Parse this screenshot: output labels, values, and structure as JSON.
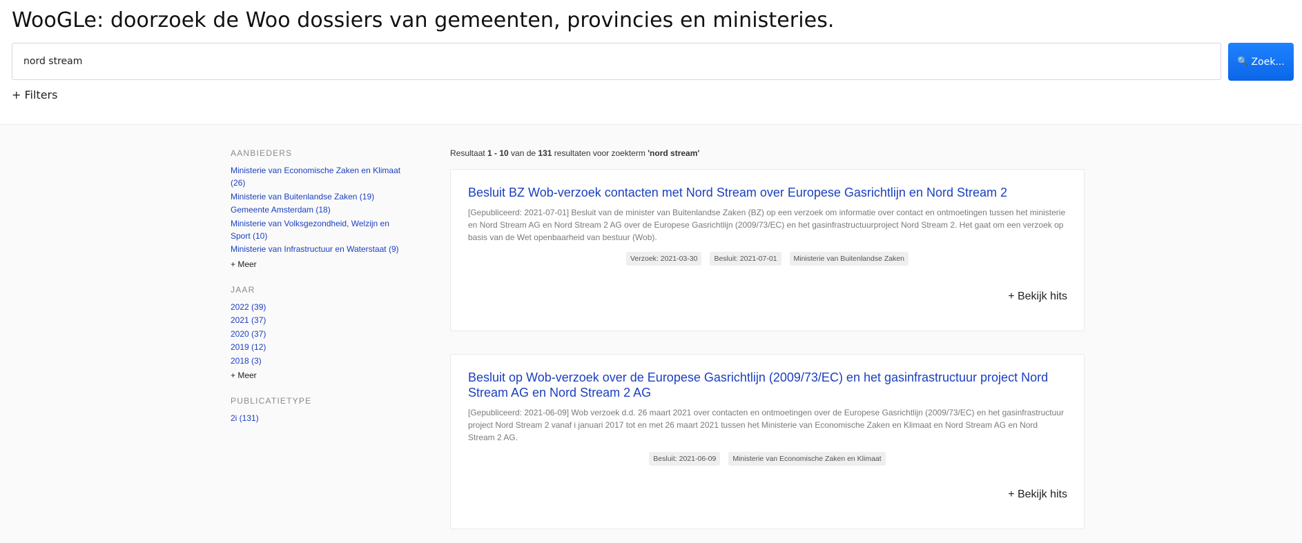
{
  "header": {
    "title": "WooGLe: doorzoek de Woo dossiers van gemeenten, provincies en ministeries.",
    "search_value": "nord stream",
    "search_button_label": "Zoek...",
    "search_icon": "magnifier-icon",
    "filters_label": "+ Filters"
  },
  "sidebar": {
    "groups": [
      {
        "heading": "AANBIEDERS",
        "items": [
          "Ministerie van Economische Zaken en Klimaat (26)",
          "Ministerie van Buitenlandse Zaken (19)",
          "Gemeente Amsterdam (18)",
          "Ministerie van Volksgezondheid, Welzijn en Sport (10)",
          "Ministerie van Infrastructuur en Waterstaat (9)"
        ],
        "more_label": "+ Meer"
      },
      {
        "heading": "JAAR",
        "items": [
          "2022 (39)",
          "2021 (37)",
          "2020 (37)",
          "2019 (12)",
          "2018 (3)"
        ],
        "more_label": "+ Meer"
      },
      {
        "heading": "PUBLICATIETYPE",
        "items": [
          "2i (131)"
        ]
      }
    ]
  },
  "results": {
    "summary": {
      "prefix": "Resultaat ",
      "range": "1 - 10",
      "mid": " van de ",
      "total": "131",
      "suffix": " resultaten voor zoekterm ",
      "query": "'nord stream'"
    },
    "items": [
      {
        "title": "Besluit BZ Wob-verzoek contacten met Nord Stream over Europese Gasrichtlijn en Nord Stream 2",
        "snippet": "[Gepubliceerd: 2021-07-01] Besluit van de minister van Buitenlandse Zaken (BZ) op een verzoek om informatie over contact en ontmoetingen tussen het ministerie en Nord Stream AG en Nord Stream 2 AG over de Europese Gasrichtlijn (2009/73/EC) en het gasinfrastructuurproject Nord Stream 2. Het gaat om een verzoek op basis van de Wet openbaarheid van bestuur (Wob).",
        "tags": [
          "Verzoek: 2021-03-30",
          "Besluit: 2021-07-01",
          "Ministerie van Buitenlandse Zaken"
        ],
        "hits_label": "+ Bekijk hits"
      },
      {
        "title": "Besluit op Wob-verzoek over de Europese Gasrichtlijn (2009/73/EC) en het gasinfrastructuur project Nord Stream AG en Nord Stream 2 AG",
        "snippet": "[Gepubliceerd: 2021-06-09] Wob verzoek d.d. 26 maart 2021 over contacten en ontmoetingen over de Europese Gasrichtlijn (2009/73/EC) en het gasinfrastructuur project Nord Stream 2 vanaf i januari 2017 tot en met 26 maart 2021 tussen het Ministerie van Economische Zaken en Klimaat en Nord Stream AG en Nord Stream 2 AG.",
        "tags": [
          "Besluit: 2021-06-09",
          "Ministerie van Economische Zaken en Klimaat"
        ],
        "hits_label": "+ Bekijk hits"
      }
    ]
  }
}
